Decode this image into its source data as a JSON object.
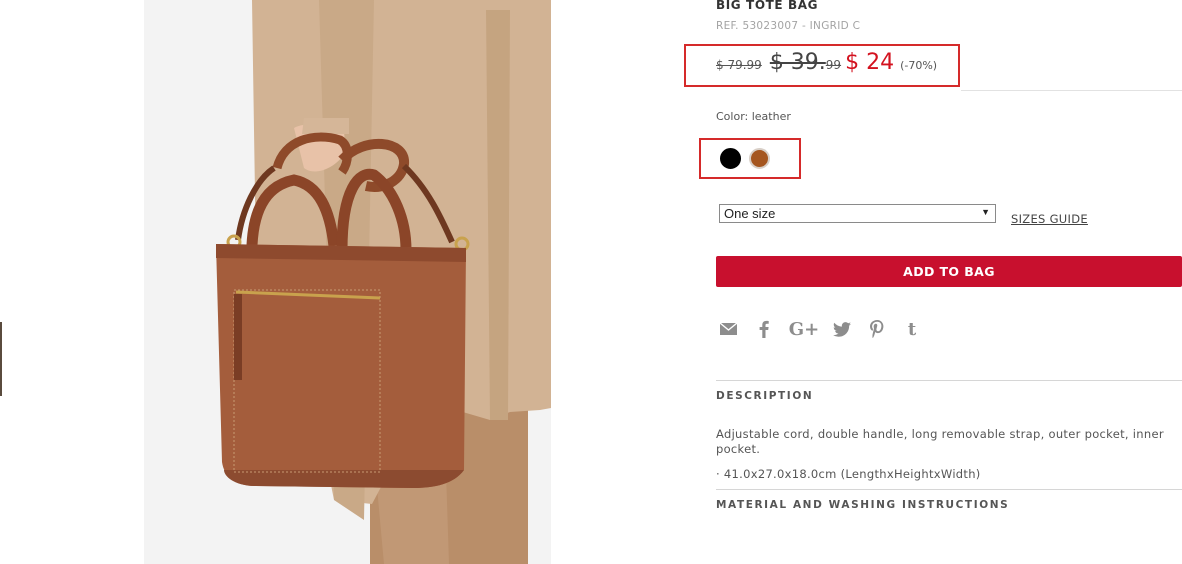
{
  "product": {
    "title": "BIG TOTE BAG",
    "ref": "REF. 53023007 - INGRID C"
  },
  "price": {
    "original": "$ 79.99",
    "previous_main": "$ 39.",
    "previous_decimals": "99",
    "sale": "$ 24",
    "discount": "(-70%)",
    "sale_color": "#d3121f"
  },
  "color": {
    "label": "Color: leather",
    "swatches": [
      {
        "name": "black",
        "hex": "#000000"
      },
      {
        "name": "leather",
        "hex": "#a5561f"
      }
    ]
  },
  "size": {
    "selected": "One size",
    "guide_label": "SIZES GUIDE"
  },
  "cart": {
    "add_label": "ADD TO BAG",
    "accent": "#c8102e"
  },
  "share": {
    "icons": [
      "mail-icon",
      "facebook-icon",
      "google-plus-icon",
      "twitter-icon",
      "pinterest-icon",
      "tumblr-icon"
    ],
    "google_plus_text": "G+",
    "tumblr_text": "t"
  },
  "description": {
    "heading": "DESCRIPTION",
    "text": "Adjustable cord, double handle, long removable strap, outer pocket, inner pocket.",
    "dimensions": "· 41.0x27.0x18.0cm (LengthxHeightxWidth)"
  },
  "material": {
    "heading": "MATERIAL AND WASHING INSTRUCTIONS"
  }
}
